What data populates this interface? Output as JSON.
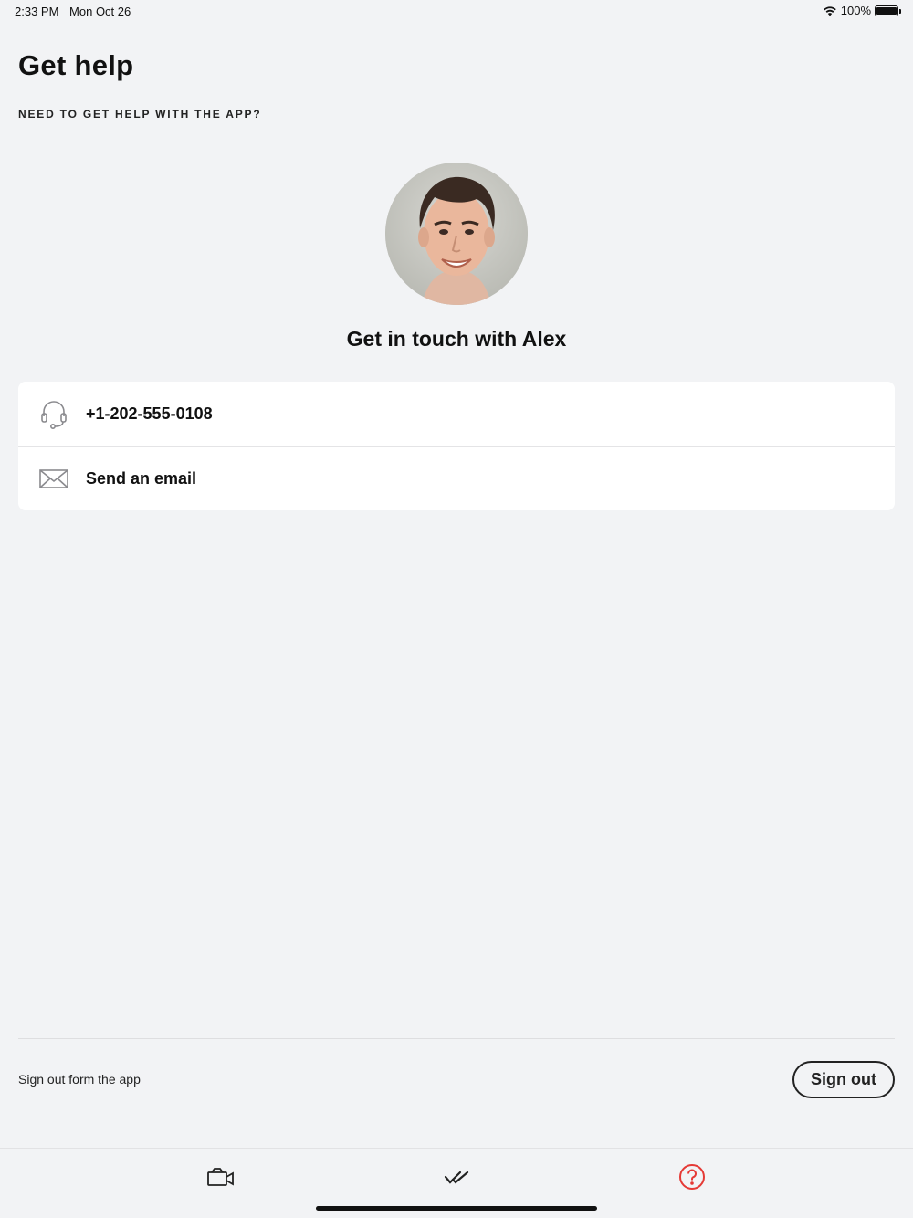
{
  "status_bar": {
    "time": "2:33 PM",
    "date": "Mon Oct 26",
    "battery": "100%"
  },
  "header": {
    "title": "Get help",
    "subtitle": "NEED TO GET HELP WITH THE APP?"
  },
  "contact": {
    "heading": "Get in touch with Alex",
    "avatar_icon": "person-photo",
    "items": [
      {
        "icon": "headset-icon",
        "label": "+1-202-555-0108"
      },
      {
        "icon": "envelope-icon",
        "label": "Send an email"
      }
    ]
  },
  "signout": {
    "text": "Sign out form the app",
    "button_label": "Sign out"
  },
  "tab_bar": {
    "tabs": [
      {
        "icon": "video-camera-icon",
        "active": false
      },
      {
        "icon": "double-check-icon",
        "active": false
      },
      {
        "icon": "help-icon",
        "active": true
      }
    ],
    "active_color": "#e53935"
  }
}
